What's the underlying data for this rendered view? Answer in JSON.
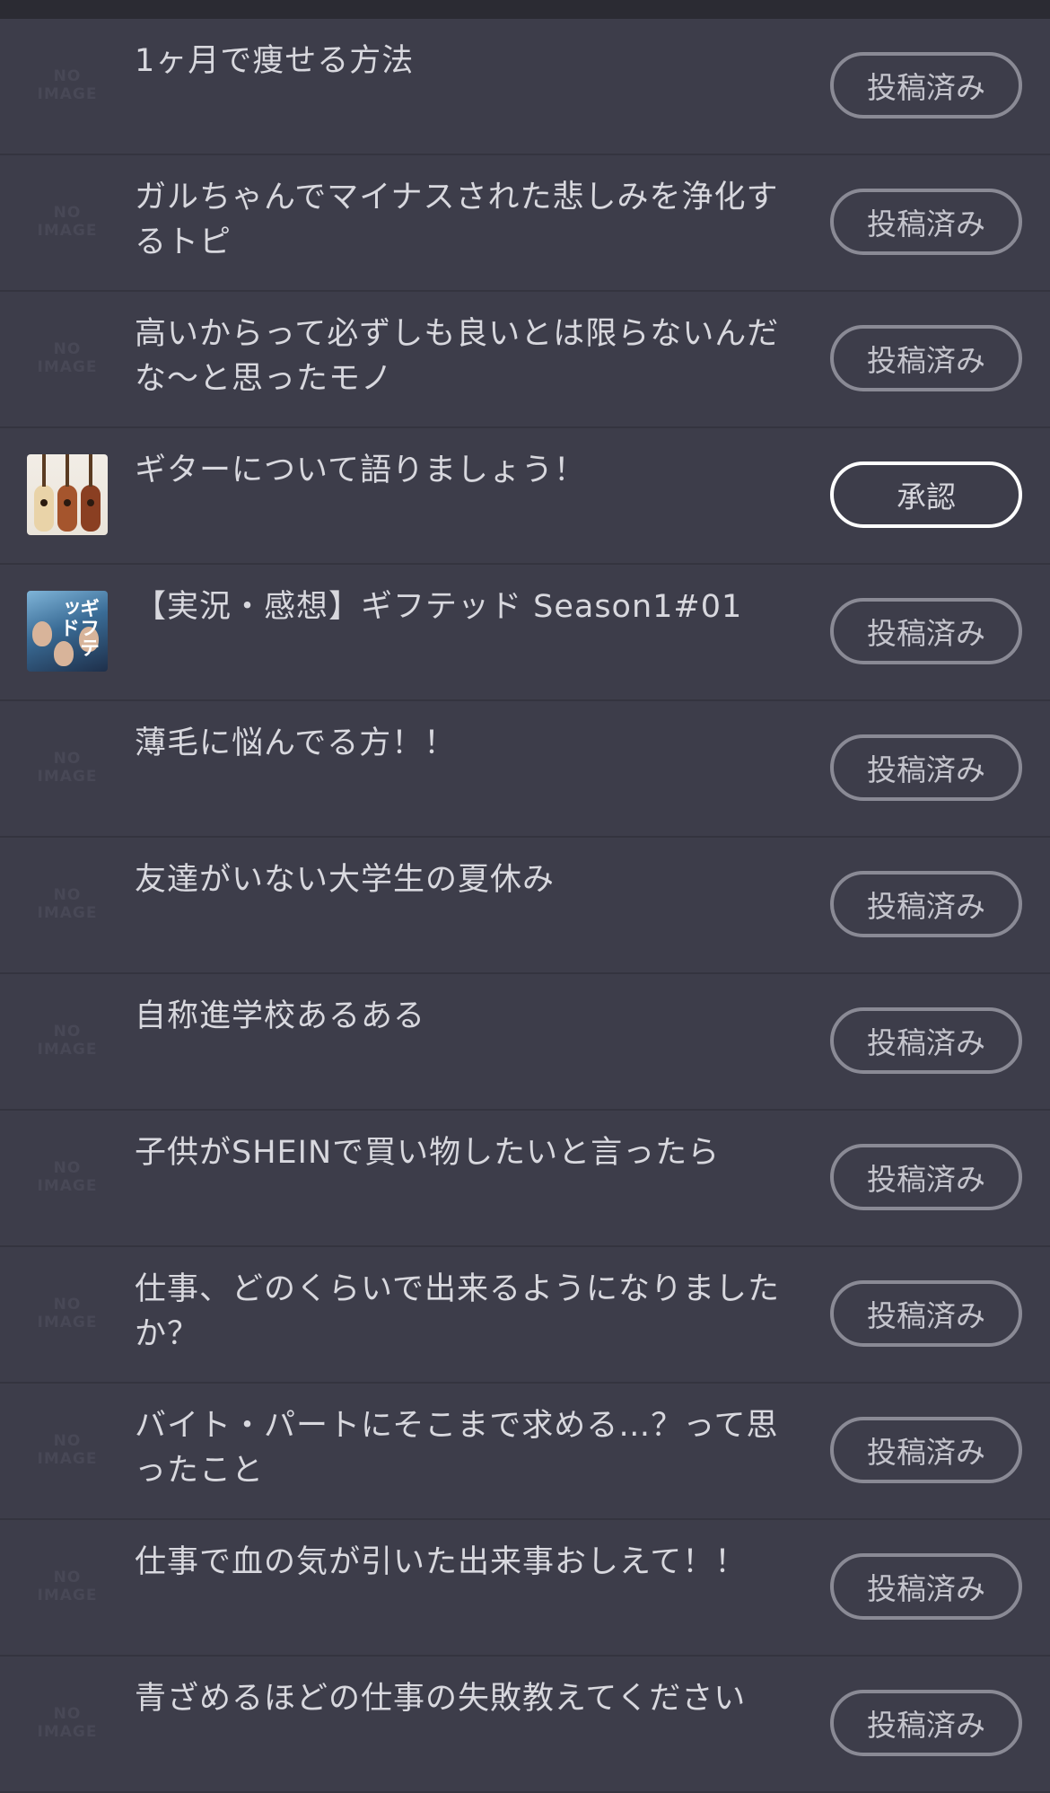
{
  "posted_label": "投稿済み",
  "approve_label": "承認",
  "no_image_label": [
    "NO",
    "IMAGE"
  ],
  "items": [
    {
      "title": "1ヶ月で痩せる方法",
      "thumb": "none",
      "status": "投稿済み"
    },
    {
      "title": "ガルちゃんでマイナスされた悲しみを浄化するトピ",
      "thumb": "none",
      "status": "投稿済み"
    },
    {
      "title": "高いからって必ずしも良いとは限らないんだな〜と思ったモノ",
      "thumb": "none",
      "status": "投稿済み"
    },
    {
      "title": "ギターについて語りましょう！",
      "thumb": "guitar",
      "status": "承認"
    },
    {
      "title": "【実況・感想】ギフテッド Season1#01",
      "thumb": "drama",
      "status": "投稿済み",
      "thumb_text": "ギフテッド"
    },
    {
      "title": "薄毛に悩んでる方！！",
      "thumb": "none",
      "status": "投稿済み"
    },
    {
      "title": "友達がいない大学生の夏休み",
      "thumb": "none",
      "status": "投稿済み"
    },
    {
      "title": "自称進学校あるある",
      "thumb": "none",
      "status": "投稿済み"
    },
    {
      "title": "子供がSHEINで買い物したいと言ったら",
      "thumb": "none",
      "status": "投稿済み"
    },
    {
      "title": "仕事、どのくらいで出来るようになりましたか？",
      "thumb": "none",
      "status": "投稿済み"
    },
    {
      "title": "バイト・パートにそこまで求める…？って思ったこと",
      "thumb": "none",
      "status": "投稿済み"
    },
    {
      "title": "仕事で血の気が引いた出来事おしえて！！",
      "thumb": "none",
      "status": "投稿済み"
    },
    {
      "title": "青ざめるほどの仕事の失敗教えてください",
      "thumb": "none",
      "status": "投稿済み"
    }
  ],
  "colors": {
    "background": "#3d3d4a",
    "topbar": "#2b2b33",
    "text": "#d8d8de",
    "button_border": "#8a8a95",
    "approve_border": "#ffffff"
  }
}
